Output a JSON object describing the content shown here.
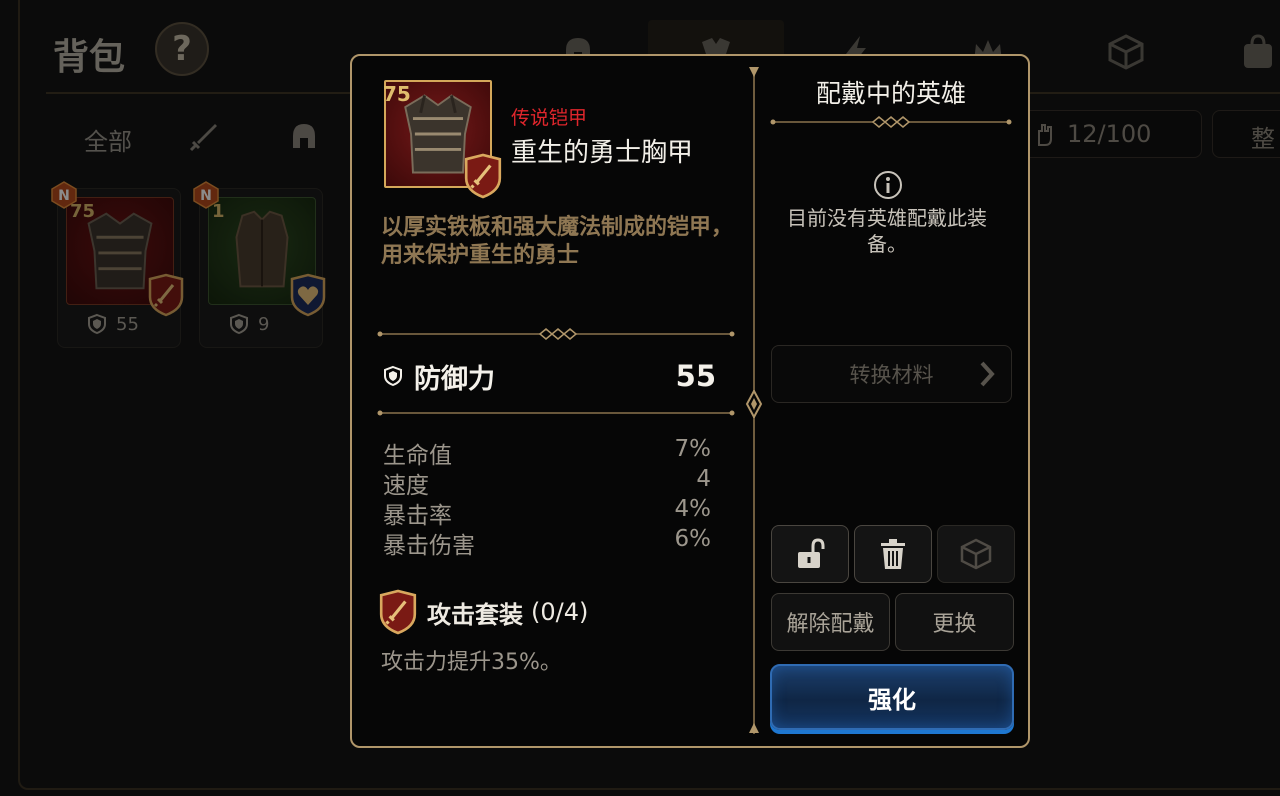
{
  "background": {
    "title": "背包",
    "help_label": "?",
    "filters": {
      "all_label": "全部"
    },
    "capacity": "12/100",
    "sort_label": "整",
    "inventory": [
      {
        "badge": "N",
        "level": "75",
        "stat_value": "55",
        "rarity_color": "red",
        "set": "attack-set"
      },
      {
        "badge": "N",
        "level": "1",
        "stat_value": "9",
        "rarity_color": "green",
        "set": "life-set"
      }
    ]
  },
  "item": {
    "level": "75",
    "rarity": "传说铠甲",
    "name": "重生的勇士胸甲",
    "description": "以厚实铁板和强大魔法制成的铠甲，用来保护重生的勇士",
    "main_stat": {
      "icon": "shield-icon",
      "label": "防御力",
      "value": "55"
    },
    "sub_stats": [
      {
        "label": "生命值",
        "value": "7%"
      },
      {
        "label": "速度",
        "value": "4"
      },
      {
        "label": "暴击率",
        "value": "4%"
      },
      {
        "label": "暴击伤害",
        "value": "6%"
      }
    ],
    "set": {
      "name": "攻击套装",
      "progress": "(0/4)",
      "effect": "攻击力提升35%。"
    }
  },
  "equipped": {
    "title": "配戴中的英雄",
    "empty_message": "目前没有英雄配戴此装备。",
    "convert_label": "转换材料",
    "unequip_label": "解除配戴",
    "replace_label": "更换",
    "enhance_label": "强化"
  },
  "colors": {
    "frame_gold": "#b0966a",
    "legendary_red": "#e0262c",
    "description_brown": "#8f7753",
    "enhance_blue": "#1e77d0"
  }
}
